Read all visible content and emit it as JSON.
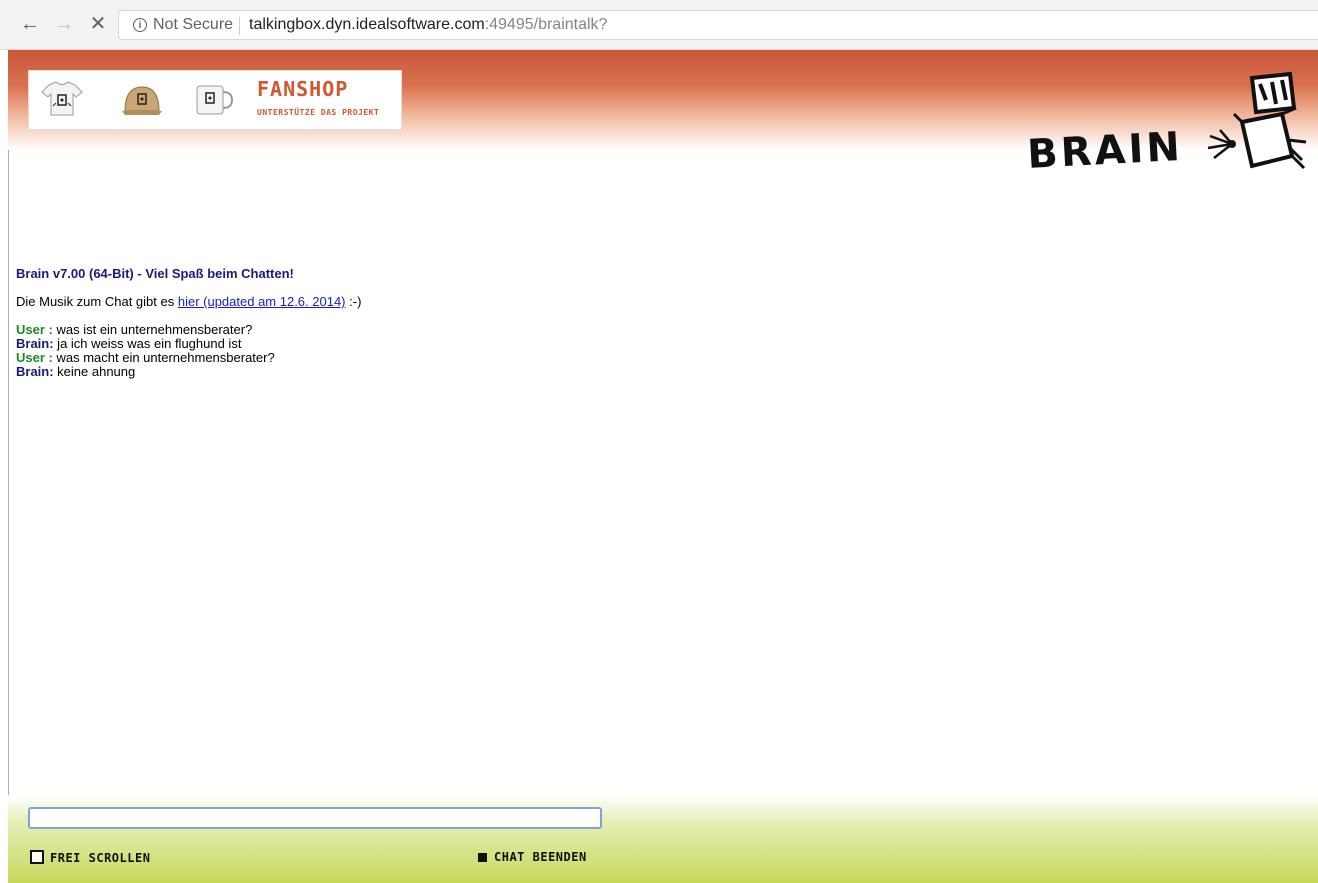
{
  "browser": {
    "back_icon": "arrow-left-icon",
    "forward_icon": "arrow-right-icon",
    "stop_icon": "close-icon",
    "security_text": "Not Secure",
    "url_host": "talkingbox.dyn.idealsoftware.com",
    "url_rest": ":49495/braintalk?"
  },
  "header": {
    "fanshop_title": "FANSHOP",
    "fanshop_subtitle": "UNTERSTÜTZE DAS PROJEKT",
    "brain_logo_text": "BRAIN"
  },
  "main": {
    "welcome": "Brain v7.00 (64-Bit) - Viel Spaß beim Chatten!",
    "music_prefix": "Die Musik zum Chat gibt es ",
    "music_link": "hier (updated am 12.6. 2014)",
    "music_suffix": " :-)",
    "chat": [
      {
        "speaker": "User :",
        "text": " was ist ein unternehmensberater?"
      },
      {
        "speaker": "Brain:",
        "text": " ja ich weiss was ein flughund ist"
      },
      {
        "speaker": "User :",
        "text": " was macht ein unternehmensberater?"
      },
      {
        "speaker": "Brain:",
        "text": " keine ahnung"
      }
    ]
  },
  "footer": {
    "input_value": "",
    "free_scroll_label": "FREI SCROLLEN",
    "end_chat_label": "CHAT BEENDEN"
  },
  "colors": {
    "header_orange": "#c7573a",
    "fanshop_orange": "#d0572f",
    "footer_green": "#c8d85a",
    "user_green": "#1f8a1f",
    "brain_blue": "#1a1a7a",
    "link_blue": "#1a1ad0"
  }
}
